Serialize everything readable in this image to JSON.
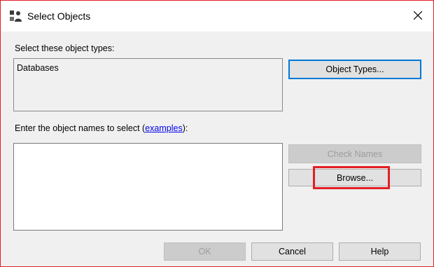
{
  "window": {
    "title": "Select Objects",
    "icon": "select-objects-icon",
    "close_icon": "close-icon"
  },
  "object_types": {
    "label": "Select these object types:",
    "value": "Databases",
    "button_label": "Object Types..."
  },
  "object_names": {
    "label_prefix": "Enter the object names to select (",
    "link_text": "examples",
    "label_suffix": "):",
    "value": ""
  },
  "buttons": {
    "check_names": "Check Names",
    "browse": "Browse...",
    "ok": "OK",
    "cancel": "Cancel",
    "help": "Help"
  },
  "colors": {
    "highlight": "#e31e24",
    "focus_border": "#0078d7",
    "link": "#0000ee"
  }
}
